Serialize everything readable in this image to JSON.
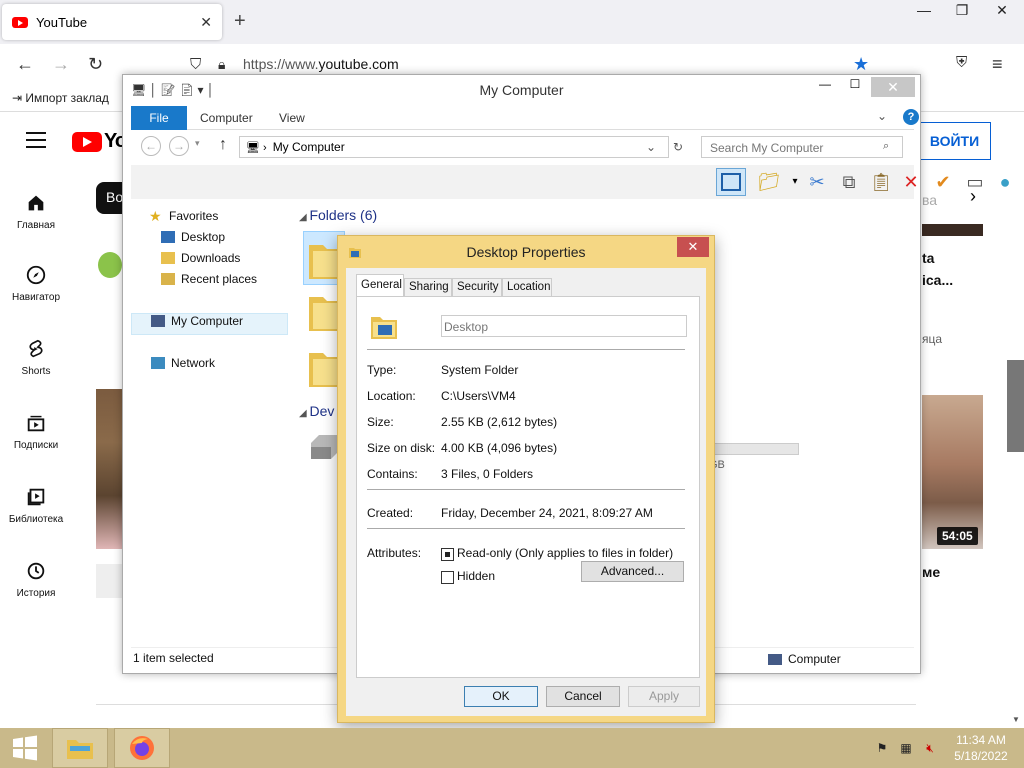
{
  "browser": {
    "tab_title": "YouTube",
    "tab_close": "✕",
    "new_tab": "+",
    "url_prefix": "https://www.",
    "url_domain": "youtube.com",
    "bookmark_label": "Импорт заклад"
  },
  "youtube": {
    "logo_text": "Yo",
    "login_label": "ВОЙТИ",
    "chip_label": "Во",
    "sidebar": [
      {
        "label": "Главная"
      },
      {
        "label": "Навигатор"
      },
      {
        "label": "Shorts"
      },
      {
        "label": "Подписки"
      },
      {
        "label": "Библиотека"
      },
      {
        "label": "История"
      }
    ],
    "right_text_1": "ta",
    "right_text_2": "ica...",
    "right_text_3": "яца",
    "right_text_4": "ме",
    "right_text_5": "ва",
    "duration": "54:05"
  },
  "explorer": {
    "title": "My Computer",
    "ribbon": {
      "file": "File",
      "computer": "Computer",
      "view": "View",
      "help": "?"
    },
    "address": "My Computer",
    "search_placeholder": "Search My Computer",
    "nav": {
      "favorites": "Favorites",
      "desktop": "Desktop",
      "downloads": "Downloads",
      "recent": "Recent places",
      "my_computer": "My Computer",
      "network": "Network"
    },
    "folders_header": "Folders (6)",
    "devices_header": "Dev",
    "drive_size_suffix": "GB",
    "status_left": "1 item selected",
    "status_right": "Computer"
  },
  "dialog": {
    "title": "Desktop Properties",
    "tabs": [
      "General",
      "Sharing",
      "Security",
      "Location"
    ],
    "name_value": "Desktop",
    "props": {
      "type_label": "Type:",
      "type_value": "System Folder",
      "location_label": "Location:",
      "location_value": "C:\\Users\\VM4",
      "size_label": "Size:",
      "size_value": "2.55 KB (2,612 bytes)",
      "size_disk_label": "Size on disk:",
      "size_disk_value": "4.00 KB (4,096 bytes)",
      "contains_label": "Contains:",
      "contains_value": "3 Files, 0 Folders",
      "created_label": "Created:",
      "created_value": "Friday, December 24, 2021, 8:09:27 AM",
      "attributes_label": "Attributes:"
    },
    "readonly_label": "Read-only (Only applies to files in folder)",
    "hidden_label": "Hidden",
    "advanced_label": "Advanced...",
    "ok_label": "OK",
    "cancel_label": "Cancel",
    "apply_label": "Apply"
  },
  "taskbar": {
    "time": "11:34 AM",
    "date": "5/18/2022"
  }
}
